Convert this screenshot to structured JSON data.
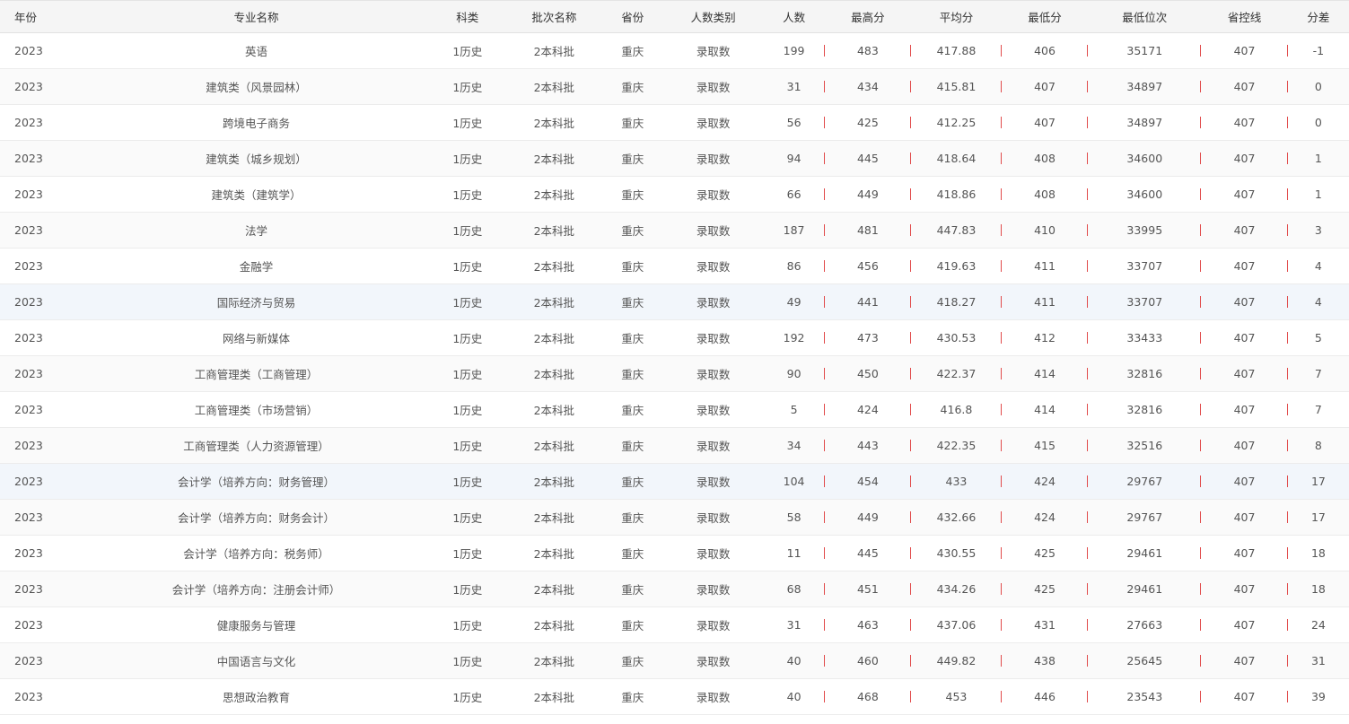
{
  "headers": [
    "年份",
    "专业名称",
    "科类",
    "批次名称",
    "省份",
    "人数类别",
    "人数",
    "最高分",
    "平均分",
    "最低分",
    "最低位次",
    "省控线",
    "分差"
  ],
  "rows": [
    [
      "2023",
      "英语",
      "1历史",
      "2本科批",
      "重庆",
      "录取数",
      "199",
      "483",
      "417.88",
      "406",
      "35171",
      "407",
      "-1"
    ],
    [
      "2023",
      "建筑类（风景园林）",
      "1历史",
      "2本科批",
      "重庆",
      "录取数",
      "31",
      "434",
      "415.81",
      "407",
      "34897",
      "407",
      "0"
    ],
    [
      "2023",
      "跨境电子商务",
      "1历史",
      "2本科批",
      "重庆",
      "录取数",
      "56",
      "425",
      "412.25",
      "407",
      "34897",
      "407",
      "0"
    ],
    [
      "2023",
      "建筑类（城乡规划）",
      "1历史",
      "2本科批",
      "重庆",
      "录取数",
      "94",
      "445",
      "418.64",
      "408",
      "34600",
      "407",
      "1"
    ],
    [
      "2023",
      "建筑类（建筑学）",
      "1历史",
      "2本科批",
      "重庆",
      "录取数",
      "66",
      "449",
      "418.86",
      "408",
      "34600",
      "407",
      "1"
    ],
    [
      "2023",
      "法学",
      "1历史",
      "2本科批",
      "重庆",
      "录取数",
      "187",
      "481",
      "447.83",
      "410",
      "33995",
      "407",
      "3"
    ],
    [
      "2023",
      "金融学",
      "1历史",
      "2本科批",
      "重庆",
      "录取数",
      "86",
      "456",
      "419.63",
      "411",
      "33707",
      "407",
      "4"
    ],
    [
      "2023",
      "国际经济与贸易",
      "1历史",
      "2本科批",
      "重庆",
      "录取数",
      "49",
      "441",
      "418.27",
      "411",
      "33707",
      "407",
      "4"
    ],
    [
      "2023",
      "网络与新媒体",
      "1历史",
      "2本科批",
      "重庆",
      "录取数",
      "192",
      "473",
      "430.53",
      "412",
      "33433",
      "407",
      "5"
    ],
    [
      "2023",
      "工商管理类（工商管理）",
      "1历史",
      "2本科批",
      "重庆",
      "录取数",
      "90",
      "450",
      "422.37",
      "414",
      "32816",
      "407",
      "7"
    ],
    [
      "2023",
      "工商管理类（市场营销）",
      "1历史",
      "2本科批",
      "重庆",
      "录取数",
      "5",
      "424",
      "416.8",
      "414",
      "32816",
      "407",
      "7"
    ],
    [
      "2023",
      "工商管理类（人力资源管理）",
      "1历史",
      "2本科批",
      "重庆",
      "录取数",
      "34",
      "443",
      "422.35",
      "415",
      "32516",
      "407",
      "8"
    ],
    [
      "2023",
      "会计学（培养方向：财务管理）",
      "1历史",
      "2本科批",
      "重庆",
      "录取数",
      "104",
      "454",
      "433",
      "424",
      "29767",
      "407",
      "17"
    ],
    [
      "2023",
      "会计学（培养方向：财务会计）",
      "1历史",
      "2本科批",
      "重庆",
      "录取数",
      "58",
      "449",
      "432.66",
      "424",
      "29767",
      "407",
      "17"
    ],
    [
      "2023",
      "会计学（培养方向：税务师）",
      "1历史",
      "2本科批",
      "重庆",
      "录取数",
      "11",
      "445",
      "430.55",
      "425",
      "29461",
      "407",
      "18"
    ],
    [
      "2023",
      "会计学（培养方向：注册会计师）",
      "1历史",
      "2本科批",
      "重庆",
      "录取数",
      "68",
      "451",
      "434.26",
      "425",
      "29461",
      "407",
      "18"
    ],
    [
      "2023",
      "健康服务与管理",
      "1历史",
      "2本科批",
      "重庆",
      "录取数",
      "31",
      "463",
      "437.06",
      "431",
      "27663",
      "407",
      "24"
    ],
    [
      "2023",
      "中国语言与文化",
      "1历史",
      "2本科批",
      "重庆",
      "录取数",
      "40",
      "460",
      "449.82",
      "438",
      "25645",
      "407",
      "31"
    ],
    [
      "2023",
      "思想政治教育",
      "1历史",
      "2本科批",
      "重庆",
      "录取数",
      "40",
      "468",
      "453",
      "446",
      "23543",
      "407",
      "39"
    ]
  ],
  "highlighted_rows": [
    7,
    12
  ],
  "colors": {
    "separator": "#e14b4b",
    "header_bg": "#f5f5f5",
    "highlight_bg": "#f2f6fb"
  }
}
